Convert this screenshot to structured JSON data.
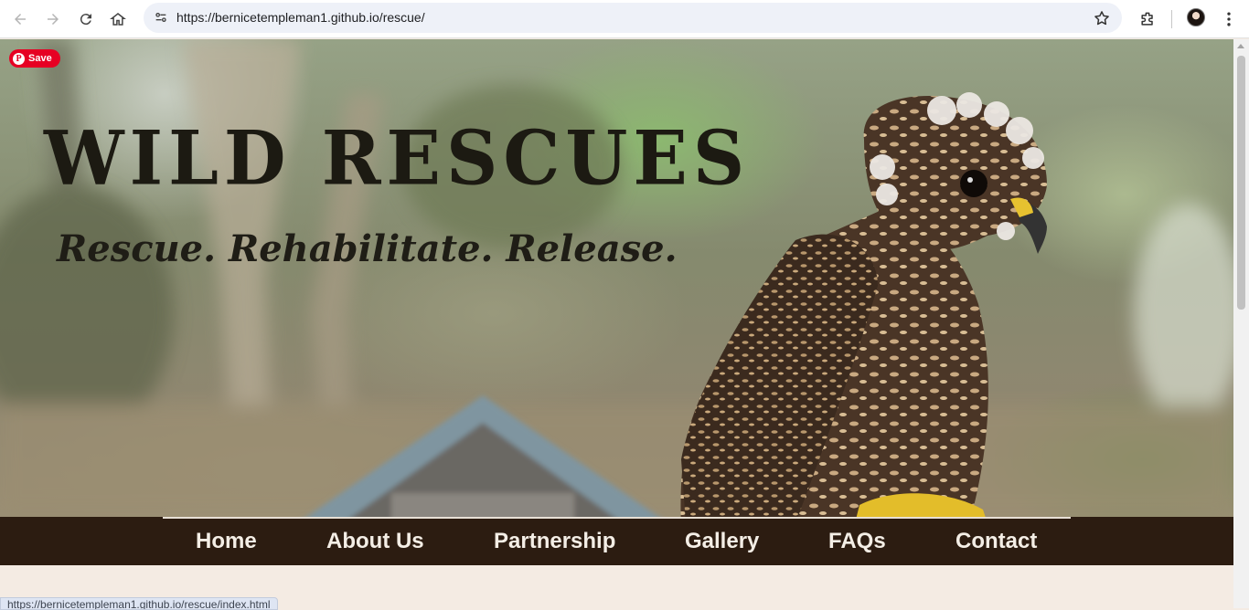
{
  "browser": {
    "url": "https://bernicetempleman1.github.io/rescue/",
    "status_url": "https://bernicetempleman1.github.io/rescue/index.html"
  },
  "hero": {
    "save_label": "Save",
    "pin_glyph": "P",
    "title": "WILD RESCUES",
    "tagline": "Rescue. Rehabilitate. Release."
  },
  "nav": {
    "items": [
      {
        "label": "Home"
      },
      {
        "label": "About Us"
      },
      {
        "label": "Partnership"
      },
      {
        "label": "Gallery"
      },
      {
        "label": "FAQs"
      },
      {
        "label": "Contact"
      }
    ]
  },
  "colors": {
    "nav_bg": "#2c1c11",
    "page_bg": "#f4ebe3",
    "pinterest_red": "#e60023",
    "title_text": "#1c1a12"
  },
  "icons": [
    "back-arrow-icon",
    "forward-arrow-icon",
    "reload-icon",
    "home-icon",
    "site-info-icon",
    "bookmark-star-icon",
    "extensions-icon",
    "kebab-menu-icon",
    "pinterest-icon"
  ]
}
